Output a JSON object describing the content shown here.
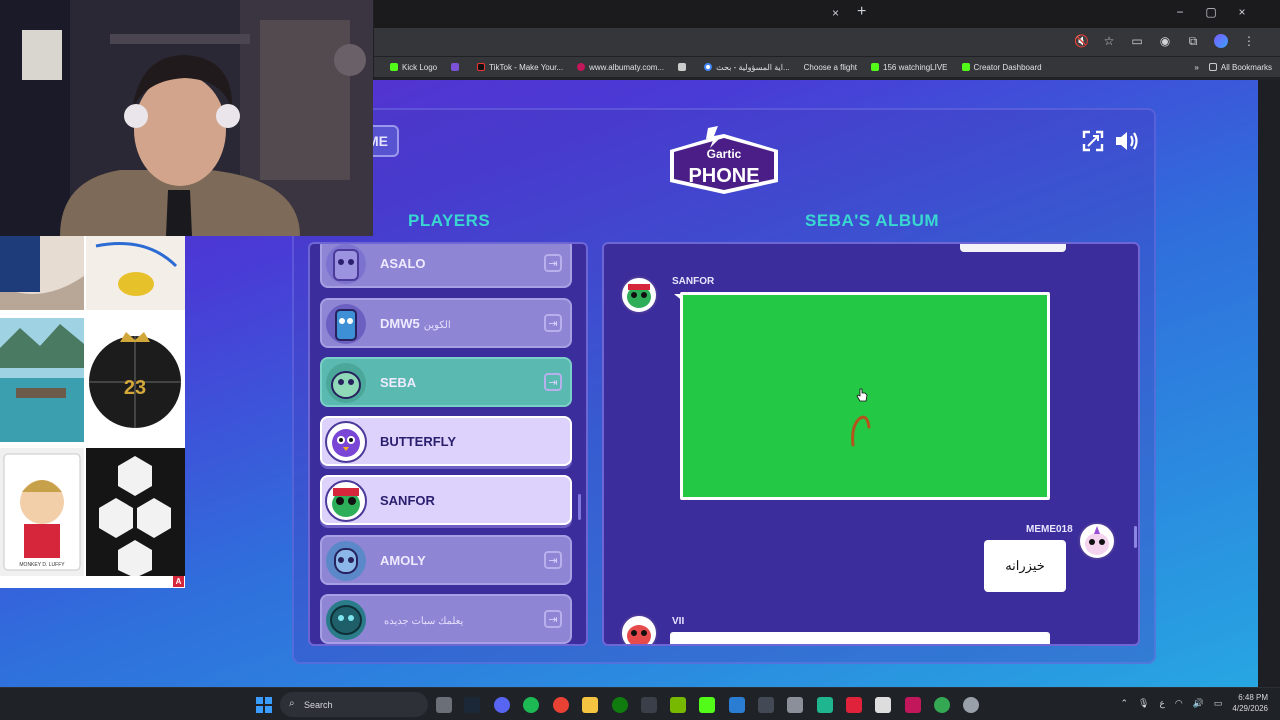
{
  "browser": {
    "tab_close": "×",
    "new_tab": "+",
    "window_controls": [
      "−",
      "▢",
      "×"
    ],
    "bookmarks": [
      {
        "label": "Kick Logo",
        "color": "#53fc18"
      },
      {
        "label": "",
        "color": "#7b52d6"
      },
      {
        "label": "TikTok - Make Your...",
        "color": "#111111"
      },
      {
        "label": "www.albumaty.com...",
        "color": "#c2185b"
      },
      {
        "label": "",
        "color": "#cccccc"
      },
      {
        "label": "اية المسؤولية - بحث...",
        "color": "#4285f4"
      },
      {
        "label": "Choose a flight",
        "color": "#cccccc"
      },
      {
        "label": "156 watchingLIVE",
        "color": "#53fc18"
      },
      {
        "label": "Creator Dashboard",
        "color": "#53fc18"
      }
    ],
    "bookmarks_more": "»",
    "all_bookmarks": "All Bookmarks"
  },
  "game": {
    "back_label": "ME",
    "logo_top": "Gartic",
    "logo_bottom": "PHONE",
    "players_heading": "PLAYERS",
    "album_heading": "SEBA'S ALBUM",
    "kick_glyph": "⇥",
    "players": [
      {
        "name": "ASALO",
        "sub": "",
        "style": "normal",
        "color": "#7c72cf"
      },
      {
        "name": "DMW5",
        "sub": "الكوين",
        "style": "normal",
        "color": "#6b5fc1"
      },
      {
        "name": "SEBA",
        "sub": "",
        "style": "seba",
        "color": "#5fb3a6"
      },
      {
        "name": "BUTTERFLY",
        "sub": "",
        "style": "active",
        "color": "#6a3fd2"
      },
      {
        "name": "SANFOR",
        "sub": "",
        "style": "active",
        "color": "#2fae5a"
      },
      {
        "name": "AMOLY",
        "sub": "",
        "style": "normal",
        "color": "#5a88c8"
      },
      {
        "name": "",
        "sub": "يعلمك سبات جديده",
        "style": "normal",
        "color": "#2a7c8a"
      }
    ],
    "album": {
      "entries": [
        {
          "author": "SANFOR",
          "type": "drawing"
        },
        {
          "author": "MEME018",
          "type": "text",
          "text": "خيزرانه"
        },
        {
          "author": "VII",
          "type": "drawing"
        }
      ]
    },
    "colors": {
      "accent_heading": "#39d7d0",
      "canvas_green": "#23c844"
    }
  },
  "taskbar": {
    "search_label": "Search",
    "time": "6:48 PM",
    "date": "4/29/2026",
    "lang": "ع"
  },
  "overlay": {
    "thumb_badge": "A",
    "funko_label": "MONKEY D. LUFFY",
    "ball_number": "23"
  }
}
